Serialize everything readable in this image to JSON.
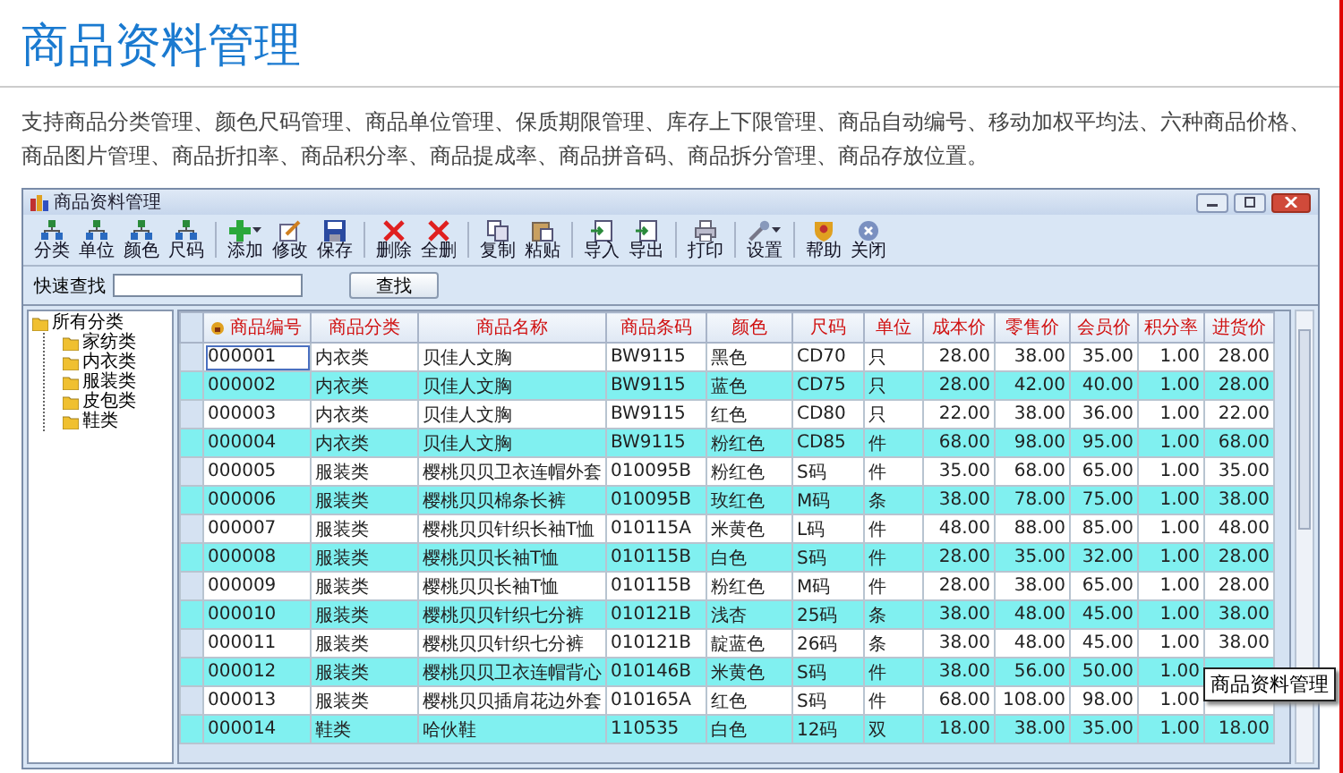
{
  "page": {
    "title": "商品资料管理",
    "description": "支持商品分类管理、颜色尺码管理、商品单位管理、保质期限管理、库存上下限管理、商品自动编号、移动加权平均法、六种商品价格、商品图片管理、商品折扣率、商品积分率、商品提成率、商品拼音码、商品拆分管理、商品存放位置。"
  },
  "window": {
    "title": "商品资料管理"
  },
  "toolbar": [
    {
      "buttons": [
        {
          "label": "分类",
          "kind": "tree",
          "dropdown": false
        },
        {
          "label": "单位",
          "kind": "tree",
          "dropdown": false
        },
        {
          "label": "颜色",
          "kind": "tree",
          "dropdown": false
        },
        {
          "label": "尺码",
          "kind": "tree",
          "dropdown": false
        }
      ]
    },
    {
      "buttons": [
        {
          "label": "添加",
          "kind": "add",
          "dropdown": true
        },
        {
          "label": "修改",
          "kind": "edit",
          "dropdown": false
        },
        {
          "label": "保存",
          "kind": "save",
          "dropdown": false
        }
      ]
    },
    {
      "buttons": [
        {
          "label": "删除",
          "kind": "delete",
          "dropdown": false
        },
        {
          "label": "全删",
          "kind": "delete",
          "dropdown": false
        }
      ]
    },
    {
      "buttons": [
        {
          "label": "复制",
          "kind": "copy",
          "dropdown": false
        },
        {
          "label": "粘贴",
          "kind": "paste",
          "dropdown": false
        }
      ]
    },
    {
      "buttons": [
        {
          "label": "导入",
          "kind": "import",
          "dropdown": false
        },
        {
          "label": "导出",
          "kind": "import",
          "dropdown": false
        }
      ]
    },
    {
      "buttons": [
        {
          "label": "打印",
          "kind": "print",
          "dropdown": false
        }
      ]
    },
    {
      "buttons": [
        {
          "label": "设置",
          "kind": "settings",
          "dropdown": true
        }
      ]
    },
    {
      "buttons": [
        {
          "label": "帮助",
          "kind": "help",
          "dropdown": false
        },
        {
          "label": "关闭",
          "kind": "close",
          "dropdown": false
        }
      ]
    }
  ],
  "search": {
    "label": "快速查找",
    "button": "查找"
  },
  "tree": {
    "label": "所有分类",
    "expanded": true,
    "children": [
      {
        "label": "家纺类"
      },
      {
        "label": "内衣类"
      },
      {
        "label": "服装类"
      },
      {
        "label": "皮包类"
      },
      {
        "label": "鞋类"
      }
    ]
  },
  "table": {
    "columns": [
      {
        "label": "商品编号"
      },
      {
        "label": "商品分类"
      },
      {
        "label": "商品名称"
      },
      {
        "label": "商品条码"
      },
      {
        "label": "颜色"
      },
      {
        "label": "尺码"
      },
      {
        "label": "单位"
      },
      {
        "label": "成本价"
      },
      {
        "label": "零售价"
      },
      {
        "label": "会员价"
      },
      {
        "label": "积分率"
      },
      {
        "label": "进货价"
      }
    ],
    "rows": [
      {
        "selected": true,
        "cells": [
          "000001",
          "内衣类",
          "贝佳人文胸",
          "BW9115",
          "黑色",
          "CD70",
          "只",
          "28.00",
          "38.00",
          "35.00",
          "1.00",
          "28.00"
        ]
      },
      {
        "selected": false,
        "cells": [
          "000002",
          "内衣类",
          "贝佳人文胸",
          "BW9115",
          "蓝色",
          "CD75",
          "只",
          "28.00",
          "42.00",
          "40.00",
          "1.00",
          "28.00"
        ]
      },
      {
        "selected": false,
        "cells": [
          "000003",
          "内衣类",
          "贝佳人文胸",
          "BW9115",
          "红色",
          "CD80",
          "只",
          "22.00",
          "38.00",
          "36.00",
          "1.00",
          "22.00"
        ]
      },
      {
        "selected": false,
        "cells": [
          "000004",
          "内衣类",
          "贝佳人文胸",
          "BW9115",
          "粉红色",
          "CD85",
          "件",
          "68.00",
          "98.00",
          "95.00",
          "1.00",
          "68.00"
        ]
      },
      {
        "selected": false,
        "cells": [
          "000005",
          "服装类",
          "樱桃贝贝卫衣连帽外套",
          "010095B",
          "粉红色",
          "S码",
          "件",
          "35.00",
          "68.00",
          "65.00",
          "1.00",
          "35.00"
        ]
      },
      {
        "selected": false,
        "cells": [
          "000006",
          "服装类",
          "樱桃贝贝棉条长裤",
          "010095B",
          "玫红色",
          "M码",
          "条",
          "38.00",
          "78.00",
          "75.00",
          "1.00",
          "38.00"
        ]
      },
      {
        "selected": false,
        "cells": [
          "000007",
          "服装类",
          "樱桃贝贝针织长袖T恤",
          "010115A",
          "米黄色",
          "L码",
          "件",
          "48.00",
          "88.00",
          "85.00",
          "1.00",
          "48.00"
        ]
      },
      {
        "selected": false,
        "cells": [
          "000008",
          "服装类",
          "樱桃贝贝长袖T恤",
          "010115B",
          "白色",
          "S码",
          "件",
          "28.00",
          "35.00",
          "32.00",
          "1.00",
          "28.00"
        ]
      },
      {
        "selected": false,
        "cells": [
          "000009",
          "服装类",
          "樱桃贝贝长袖T恤",
          "010115B",
          "粉红色",
          "M码",
          "件",
          "28.00",
          "38.00",
          "65.00",
          "1.00",
          "28.00"
        ]
      },
      {
        "selected": false,
        "cells": [
          "000010",
          "服装类",
          "樱桃贝贝针织七分裤",
          "010121B",
          "浅杏",
          "25码",
          "条",
          "38.00",
          "48.00",
          "45.00",
          "1.00",
          "38.00"
        ]
      },
      {
        "selected": false,
        "cells": [
          "000011",
          "服装类",
          "樱桃贝贝针织七分裤",
          "010121B",
          "靛蓝色",
          "26码",
          "条",
          "38.00",
          "48.00",
          "45.00",
          "1.00",
          "38.00"
        ]
      },
      {
        "selected": false,
        "cells": [
          "000012",
          "服装类",
          "樱桃贝贝卫衣连帽背心",
          "010146B",
          "米黄色",
          "S码",
          "件",
          "38.00",
          "56.00",
          "50.00",
          "1.00"
        ]
      },
      {
        "selected": false,
        "cells": [
          "000013",
          "服装类",
          "樱桃贝贝插肩花边外套",
          "010165A",
          "红色",
          "S码",
          "件",
          "68.00",
          "108.00",
          "98.00",
          "1.00"
        ]
      },
      {
        "selected": false,
        "cells": [
          "000014",
          "鞋类",
          "哈伙鞋",
          "110535",
          "白色",
          "12码",
          "双",
          "18.00",
          "38.00",
          "35.00",
          "1.00",
          "18.00"
        ]
      }
    ]
  },
  "tooltip": "商品资料管理"
}
